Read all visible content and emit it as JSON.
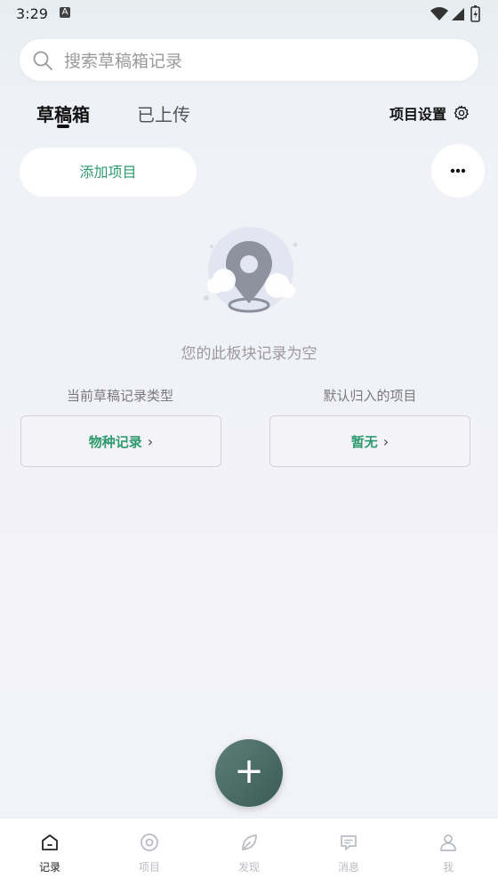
{
  "status": {
    "time": "3:29",
    "notification_badge": "A"
  },
  "search": {
    "placeholder": "搜索草稿箱记录"
  },
  "tabs": [
    {
      "label": "草稿箱",
      "active": true
    },
    {
      "label": "已上传",
      "active": false
    }
  ],
  "project_settings_label": "项目设置",
  "add_project_label": "添加项目",
  "empty_state": {
    "text": "您的此板块记录为空"
  },
  "draft_type": {
    "label": "当前草稿记录类型",
    "value": "物种记录"
  },
  "default_project": {
    "label": "默认归入的项目",
    "value": "暂无"
  },
  "fab": {
    "icon": "plus-icon"
  },
  "bottom_nav": [
    {
      "label": "记录",
      "icon": "home-icon",
      "active": true
    },
    {
      "label": "项目",
      "icon": "target-icon",
      "active": false
    },
    {
      "label": "发现",
      "icon": "leaf-icon",
      "active": false
    },
    {
      "label": "消息",
      "icon": "message-icon",
      "active": false
    },
    {
      "label": "我",
      "icon": "user-icon",
      "active": false
    }
  ],
  "colors": {
    "accent": "#2e9a6e",
    "fab": "#4a6d65",
    "inactive": "#b9bcc4"
  }
}
